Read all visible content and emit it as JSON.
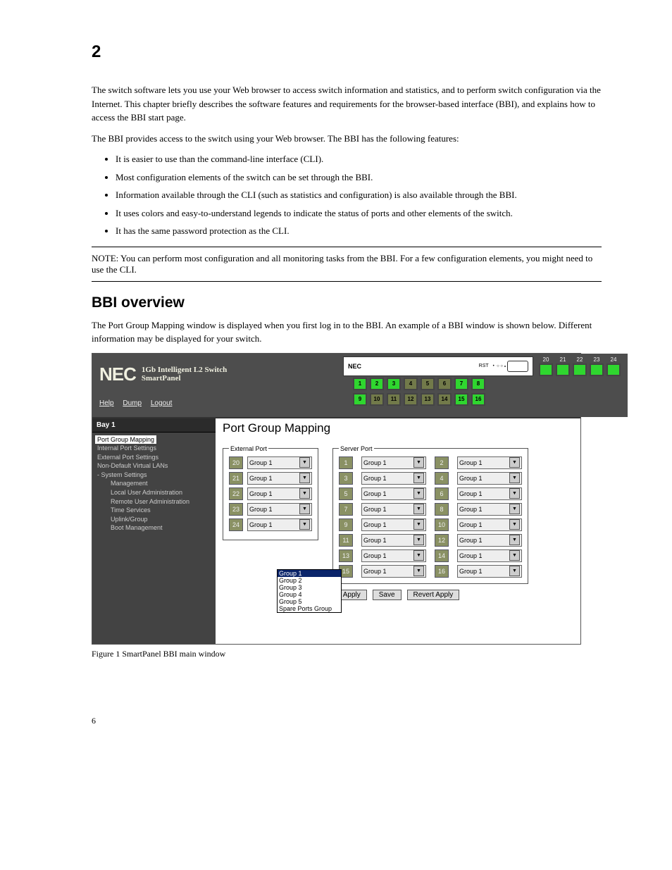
{
  "page_number": "6",
  "section_number": "2",
  "intro_para": "The switch software lets you use your Web browser to access switch information and statistics, and to perform switch configuration via the Internet. This chapter briefly describes the software features and requirements for the browser-based interface (BBI), and explains how to access the BBI start page.",
  "features_lead": "The BBI provides access to the switch using your Web browser. The BBI has the following features:",
  "features": [
    "It is easier to use than the command-line interface (CLI).",
    "Most configuration elements of the switch can be set through the BBI.",
    "Information available through the CLI (such as statistics and configuration) is also available through the BBI.",
    "It uses colors and easy-to-understand legends to indicate the status of ports and other elements of the switch.",
    "It has the same password protection as the CLI."
  ],
  "note_text": "NOTE: You can perform most configuration and all monitoring tasks from the BBI. For a few configuration elements, you might need to use the CLI.",
  "bbi_heading": "BBI overview",
  "bbi_para": "The Port Group Mapping window is displayed when you first log in to the BBI. An example of a BBI window is shown below. Different information may be displayed for your switch.",
  "fig_caption": "Figure 1 SmartPanel BBI main window",
  "ui": {
    "brand_main": "NEC",
    "brand_line1": "1Gb Intelligent L2 Switch",
    "brand_line2": "SmartPanel",
    "help": "Help",
    "dump": "Dump",
    "logout": "Logout",
    "device_nec": "NEC",
    "rst": "RST",
    "tab_bay": "Bay 1",
    "content_title": "Port Group Mapping",
    "ext_legend": "External Port",
    "srv_legend": "Server Port",
    "group_val": "Group 1",
    "apply": "Apply",
    "save": "Save",
    "revert": "Revert Apply"
  },
  "top_ports": [
    "20",
    "21",
    "22",
    "23",
    "24"
  ],
  "mid_row1": [
    "1",
    "2",
    "3",
    "4",
    "5",
    "6",
    "7",
    "8"
  ],
  "mid_row2": [
    "9",
    "10",
    "11",
    "12",
    "13",
    "14",
    "15",
    "16"
  ],
  "mid_row1_green": [
    true,
    true,
    true,
    false,
    false,
    false,
    true,
    true
  ],
  "mid_row2_green": [
    true,
    false,
    false,
    false,
    false,
    false,
    true,
    true
  ],
  "sidebar": {
    "items": [
      {
        "label": "Port Group Mapping",
        "sel": true,
        "indent": 0
      },
      {
        "label": "Internal Port Settings",
        "indent": 0
      },
      {
        "label": "External Port Settings",
        "indent": 0
      },
      {
        "label": "Non-Default Virtual LANs",
        "indent": 0
      },
      {
        "label": "System Settings",
        "indent": 0,
        "expander": "-"
      },
      {
        "label": "Management",
        "indent": 1
      },
      {
        "label": "Local User Administration",
        "indent": 1
      },
      {
        "label": "Remote User Administration",
        "indent": 1
      },
      {
        "label": "Time Services",
        "indent": 1
      },
      {
        "label": "Uplink/Group",
        "indent": 1
      },
      {
        "label": "Boot Management",
        "indent": 1
      }
    ]
  },
  "ext_ports": [
    "20",
    "21",
    "22",
    "23",
    "24"
  ],
  "srv_ports": [
    "1",
    "2",
    "3",
    "4",
    "5",
    "6",
    "7",
    "8",
    "9",
    "10",
    "11",
    "12",
    "13",
    "14",
    "15",
    "16"
  ],
  "dropdown_opts": [
    "Group 1",
    "Group 2",
    "Group 3",
    "Group 4",
    "Group 5",
    "Spare Ports Group"
  ]
}
